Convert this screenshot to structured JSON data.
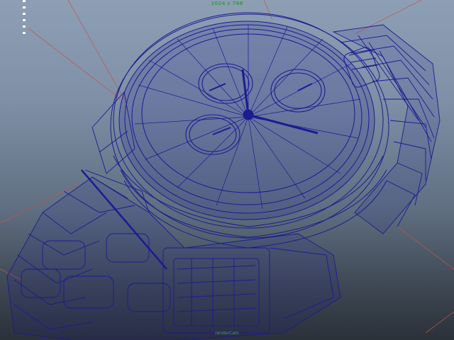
{
  "viewport": {
    "resolution_gate": "1024 x 768",
    "camera_label": "renderCam",
    "wire_color": "#1c1b92",
    "grid_color": "#c0574a",
    "background_top": "#8d9fb5",
    "background_bottom": "#2b3139"
  },
  "icons": {
    "hud": "vertical-dots-icon",
    "model": "watch-wireframe-icon"
  }
}
